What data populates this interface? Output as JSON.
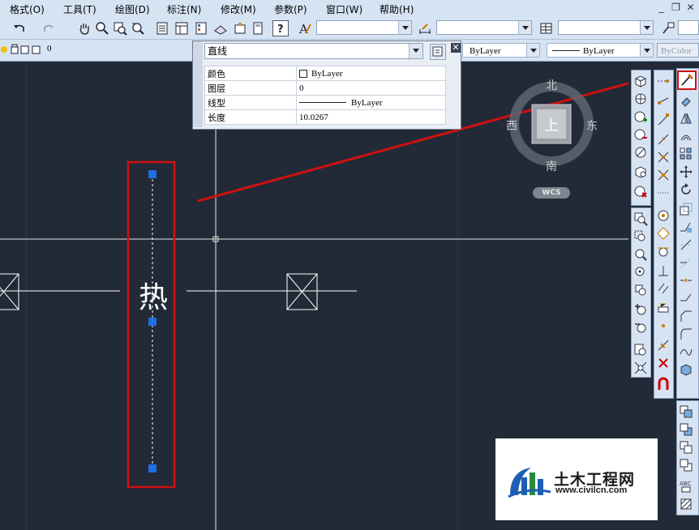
{
  "menu": {
    "items": [
      "格式(O)",
      "工具(T)",
      "绘图(D)",
      "标注(N)",
      "修改(M)",
      "参数(P)",
      "窗口(W)",
      "帮助(H)"
    ],
    "window_controls": [
      "_",
      "❐",
      "✕"
    ]
  },
  "toolbar2": {
    "layer_value": "0",
    "color_value": "ByLayer",
    "linetype_value": "ByLayer",
    "plotstyle_value": "ByColor"
  },
  "quick_properties": {
    "object_type": "直线",
    "rows": [
      {
        "label": "颜色",
        "value": "ByLayer",
        "swatch": true
      },
      {
        "label": "图层",
        "value": "0"
      },
      {
        "label": "线型",
        "value": "ByLayer",
        "line": true
      },
      {
        "label": "长度",
        "value": "10.0267"
      }
    ]
  },
  "viewcube": {
    "north": "北",
    "south": "南",
    "east": "东",
    "west": "西",
    "top_face": "上",
    "ucs": "WCS"
  },
  "drawing": {
    "symbol_text": "热"
  },
  "watermark": {
    "site_name": "土木工程网",
    "site_url": "www.civilcn.com"
  },
  "colors": {
    "canvas": "#212a36",
    "highlight_red": "#d01010",
    "grip_blue": "#1e6fe0",
    "ribbon": "#d6e3f3"
  }
}
